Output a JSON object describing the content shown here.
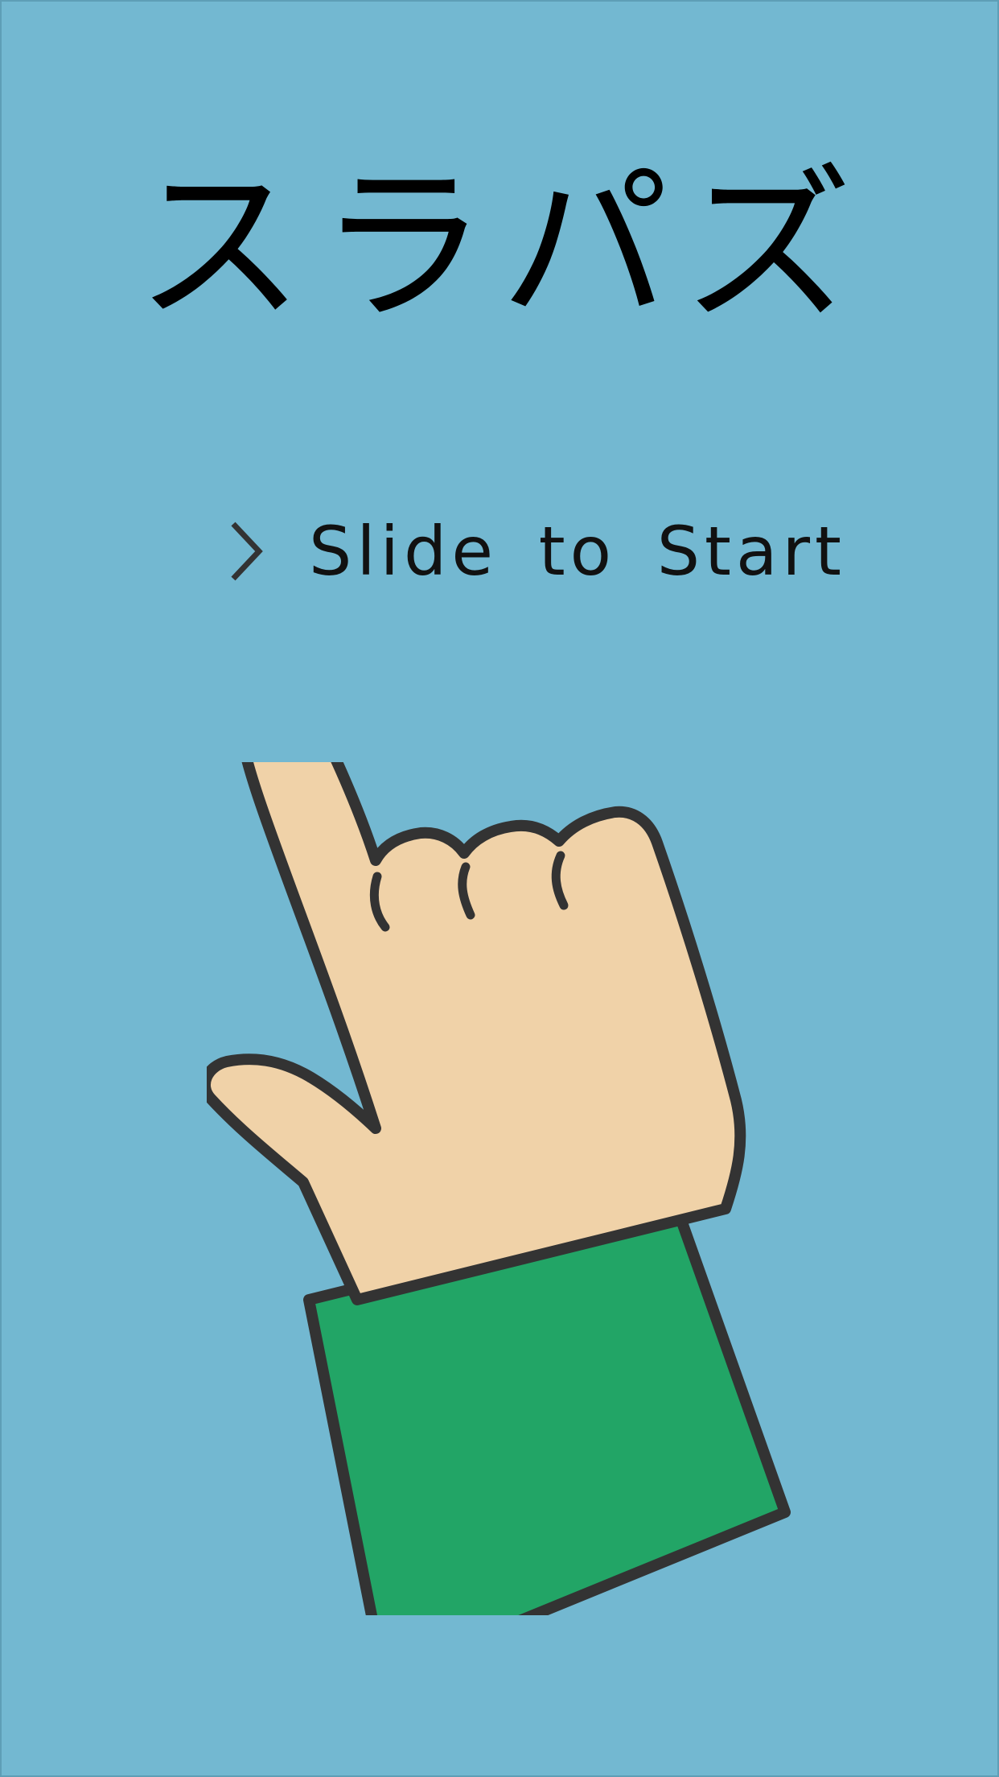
{
  "screen": {
    "background_color": "#73b8d1"
  },
  "title": {
    "text": "スラパズ"
  },
  "start_prompt": {
    "icon": "chevron-right-icon",
    "text": "Slide to Start"
  },
  "illustration": {
    "icon": "pointing-hand-icon",
    "skin_color": "#f0d2a8",
    "sleeve_color": "#22a566",
    "outline_color": "#333333"
  }
}
